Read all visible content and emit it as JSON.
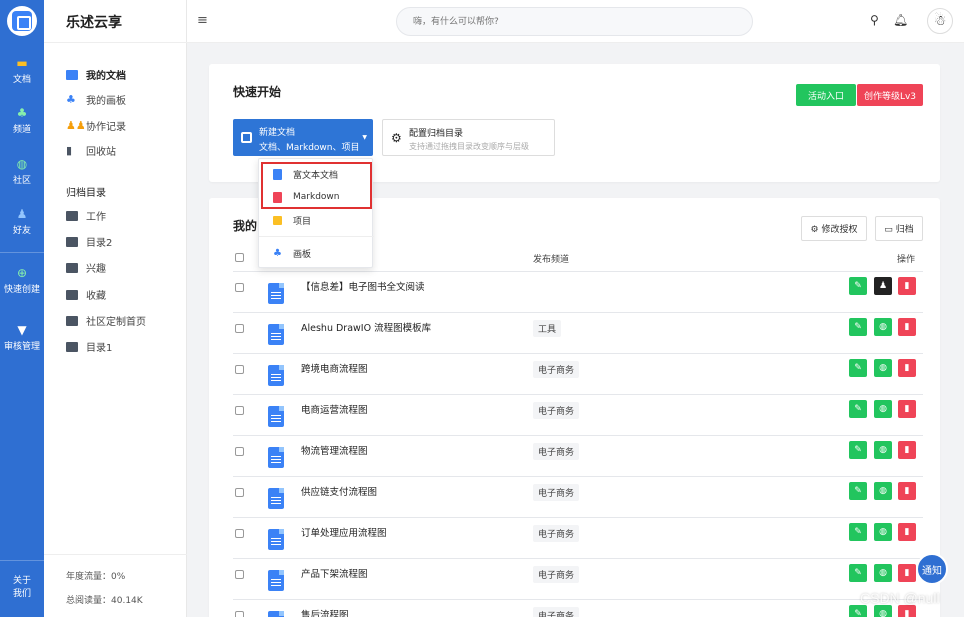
{
  "rail": {
    "items": [
      {
        "label": "文档",
        "icon": "folder-icon"
      },
      {
        "label": "频道",
        "icon": "channel-icon"
      },
      {
        "label": "社区",
        "icon": "globe-icon"
      },
      {
        "label": "好友",
        "icon": "friends-icon"
      },
      {
        "label": "快速创建",
        "icon": "plus-icon"
      },
      {
        "label": "审核管理",
        "icon": "filter-icon"
      }
    ],
    "about": "关于\n我们"
  },
  "sidebar": {
    "brand": "乐述云享",
    "nav": [
      "我的文档",
      "我的画板",
      "协作记录",
      "回收站"
    ],
    "section": "归档目录",
    "folders": [
      "工作",
      "目录2",
      "兴趣",
      "收藏",
      "社区定制首页",
      "目录1"
    ],
    "footer": {
      "traffic": "年度流量：0%",
      "reads": "总阅读量：40.14K"
    }
  },
  "header": {
    "search_placeholder": "嗨，有什么可以帮你?"
  },
  "quick": {
    "title": "快速开始",
    "activity_btn": "活动入口",
    "level_btn": "创作等级Lv3",
    "new_doc": {
      "title": "新建文档",
      "subtitle": "文档、Markdown、项目"
    },
    "config": {
      "title": "配置归档目录",
      "subtitle": "支持通过拖拽目录改变顺序与层级"
    }
  },
  "dropdown": {
    "items": [
      "富文本文档",
      "Markdown",
      "项目",
      "画板"
    ]
  },
  "list": {
    "title": "我的文档",
    "title_visible": "我的",
    "perm_btn": "修改授权",
    "archive_btn": "归档",
    "columns": {
      "channel": "发布频道",
      "ops": "操作"
    },
    "rows": [
      {
        "name": "【信息差】电子图书全文阅读",
        "tag": "",
        "second": "user"
      },
      {
        "name": "Aleshu DrawIO 流程图模板库",
        "tag": "工具",
        "second": "pub"
      },
      {
        "name": "跨境电商流程图",
        "tag": "电子商务",
        "second": "pub"
      },
      {
        "name": "电商运营流程图",
        "tag": "电子商务",
        "second": "pub"
      },
      {
        "name": "物流管理流程图",
        "tag": "电子商务",
        "second": "pub"
      },
      {
        "name": "供应链支付流程图",
        "tag": "电子商务",
        "second": "pub"
      },
      {
        "name": "订单处理应用流程图",
        "tag": "电子商务",
        "second": "pub"
      },
      {
        "name": "产品下架流程图",
        "tag": "电子商务",
        "second": "pub"
      },
      {
        "name": "售后流程图",
        "tag": "电子商务",
        "second": "pub"
      }
    ]
  },
  "float": {
    "notify": "通知",
    "watermark": "CSDN @null"
  },
  "colors": {
    "primary": "#2f6fd2",
    "green": "#22c55e",
    "red": "#ef4457",
    "highlight": "#e03131"
  }
}
